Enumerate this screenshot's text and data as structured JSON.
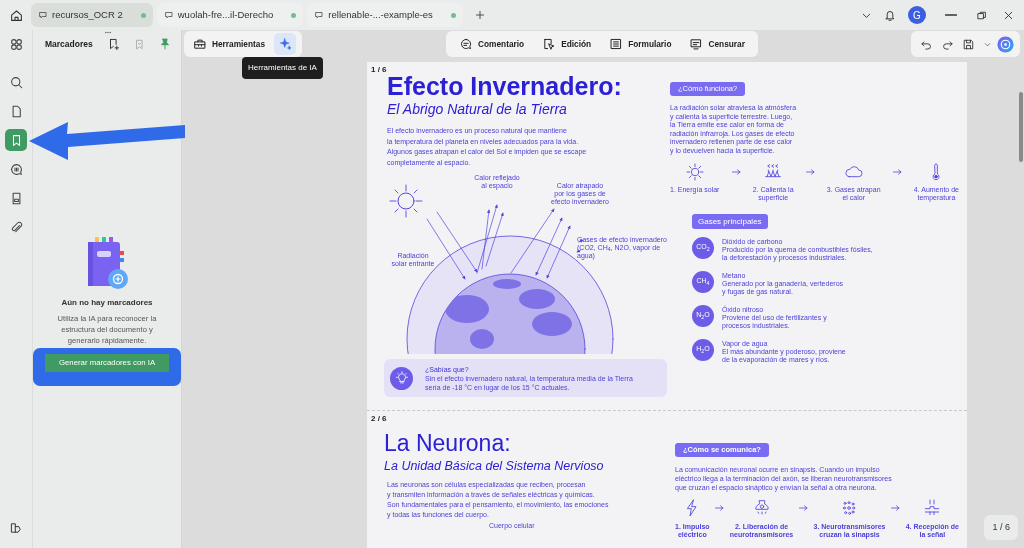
{
  "tabs": [
    {
      "label": "recursos_OCR 2",
      "selected": true
    },
    {
      "label": "wuolah-fre...il-Derecho",
      "selected": false
    },
    {
      "label": "rellenable-...-example-es",
      "selected": false
    }
  ],
  "account": {
    "initial": "G"
  },
  "rail": [
    {
      "kind": "apps",
      "selected": false
    },
    {
      "kind": "search",
      "selected": false
    },
    {
      "kind": "page",
      "selected": false
    },
    {
      "kind": "bookmark",
      "selected": true
    },
    {
      "kind": "comment",
      "selected": false
    },
    {
      "kind": "form",
      "selected": false
    },
    {
      "kind": "attachment",
      "selected": false
    }
  ],
  "bookmarks_panel": {
    "title": "Marcadores",
    "pinned": true,
    "empty_title": "Aún no hay marcadores",
    "empty_text": "Utiliza la IA para reconocer la estructura del documento y generarlo rápidamente.",
    "button": "Generar marcadores con IA"
  },
  "toolbar": {
    "tools": "Herramientas",
    "ai_selected": true,
    "tooltip": "Herramientas de IA",
    "modes": [
      {
        "kind": "comment",
        "label": "Comentario"
      },
      {
        "kind": "edit",
        "label": "Edición"
      },
      {
        "kind": "form",
        "label": "Formulario"
      },
      {
        "kind": "redact",
        "label": "Censurar"
      }
    ]
  },
  "pages": [
    {
      "kind": "greenhouse",
      "number": "1 / 6",
      "title": "Efecto Invernadero:",
      "subtitle": "El Abrigo Natural de la Tierra",
      "intro": "El efecto invernadero es un proceso natural que mantiene\nla temperatura del planeta en niveles adecuados para la vida.\nAlgunos gases atrapan el calor del Sol e impiden que se escape\ncompletamente al espacio.",
      "labels": [
        "Calor reflejado\nal espacio",
        "Calor atrapado\npor los gases de\nefecto invernadero",
        "Radiación\nsolar entrante",
        "Gases de efecto invernadero\n(CO2, CH$_{4}$, N2O, vapor de agua)"
      ],
      "fact": {
        "title": "¿Sabías que?",
        "text": "Sin el efecto invernadero natural, la temperatura media de la Tierra\nsería de -18 °C en lugar de los 15 °C actuales."
      },
      "side": {
        "badge": "¿Cómo funciona?",
        "text": "La radiación solar atraviesa la atmósfera\ny calienta la superficie terrestre. Luego,\nla Tierra emite ese calor en forma de\nradiación infrarroja. Los gases de efecto\ninvernadero retienen parte de ese calor\ny lo devuelven hacia la superficie.",
        "steps": [
          {
            "kind": "sun",
            "label": "1. Energía solar"
          },
          {
            "kind": "heat",
            "label": "2. Calienta la\nsuperficie"
          },
          {
            "kind": "cloud",
            "label": "3. Gases atrapan\nel calor"
          },
          {
            "kind": "thermometer",
            "label": "4. Aumento de\ntemperatura"
          }
        ]
      },
      "gases": {
        "title": "Gases principales",
        "items": [
          {
            "symbol": "CO$_{2}$",
            "name": "Dióxido de carbono",
            "text": "Producido por la quema de combustibles fósiles,\nla deforestación y procesos industriales."
          },
          {
            "symbol": "CH$_{4}$",
            "name": "Metano",
            "text": "Generado por la ganadería, vertederos\ny fugas de gas natural."
          },
          {
            "symbol": "N$_{2}$O",
            "name": "Óxido nitroso",
            "text": "Proviene del uso de fertilizantes y\nprocesos industriales."
          },
          {
            "symbol": "H$_{2}$O",
            "name": "Vapor de agua",
            "text": "El más abundante y poderoso, proviene\nde la evaporación de mares y ríos."
          }
        ]
      }
    },
    {
      "kind": "neuron",
      "number": "2 / 6",
      "title": "La Neurona:",
      "subtitle": "La Unidad Básica del Sistema Nervioso",
      "intro": "Las neuronas son células especializadas que reciben, procesan\ny transmiten información a través de señales eléctricas y químicas.\nSon fundamentales para el pensamiento, el movimiento, las emociones\ny todas las funciones del cuerpo.",
      "labels": [
        "Cuerpo celular"
      ],
      "side": {
        "badge": "¿Cómo se comunica?",
        "text": "La comunicación neuronal ocurre en sinapsis. Cuando un impulso\neléctrico llega a la terminación del axón, se liberan neurotransmisores\nque cruzan el espacio sináptico y envían la señal a otra neurona.",
        "steps": [
          {
            "kind": "bolt",
            "label": "1. Impulso\neléctrico"
          },
          {
            "kind": "synapse",
            "label": "2. Liberación de\nneurotransmisores"
          },
          {
            "kind": "dots",
            "label": "3. Neurotransmisores\ncruzan la sinapsis"
          },
          {
            "kind": "receptor",
            "label": "4. Recepción de\nla señal"
          }
        ]
      }
    }
  ],
  "page_indicator": "1 / 6"
}
